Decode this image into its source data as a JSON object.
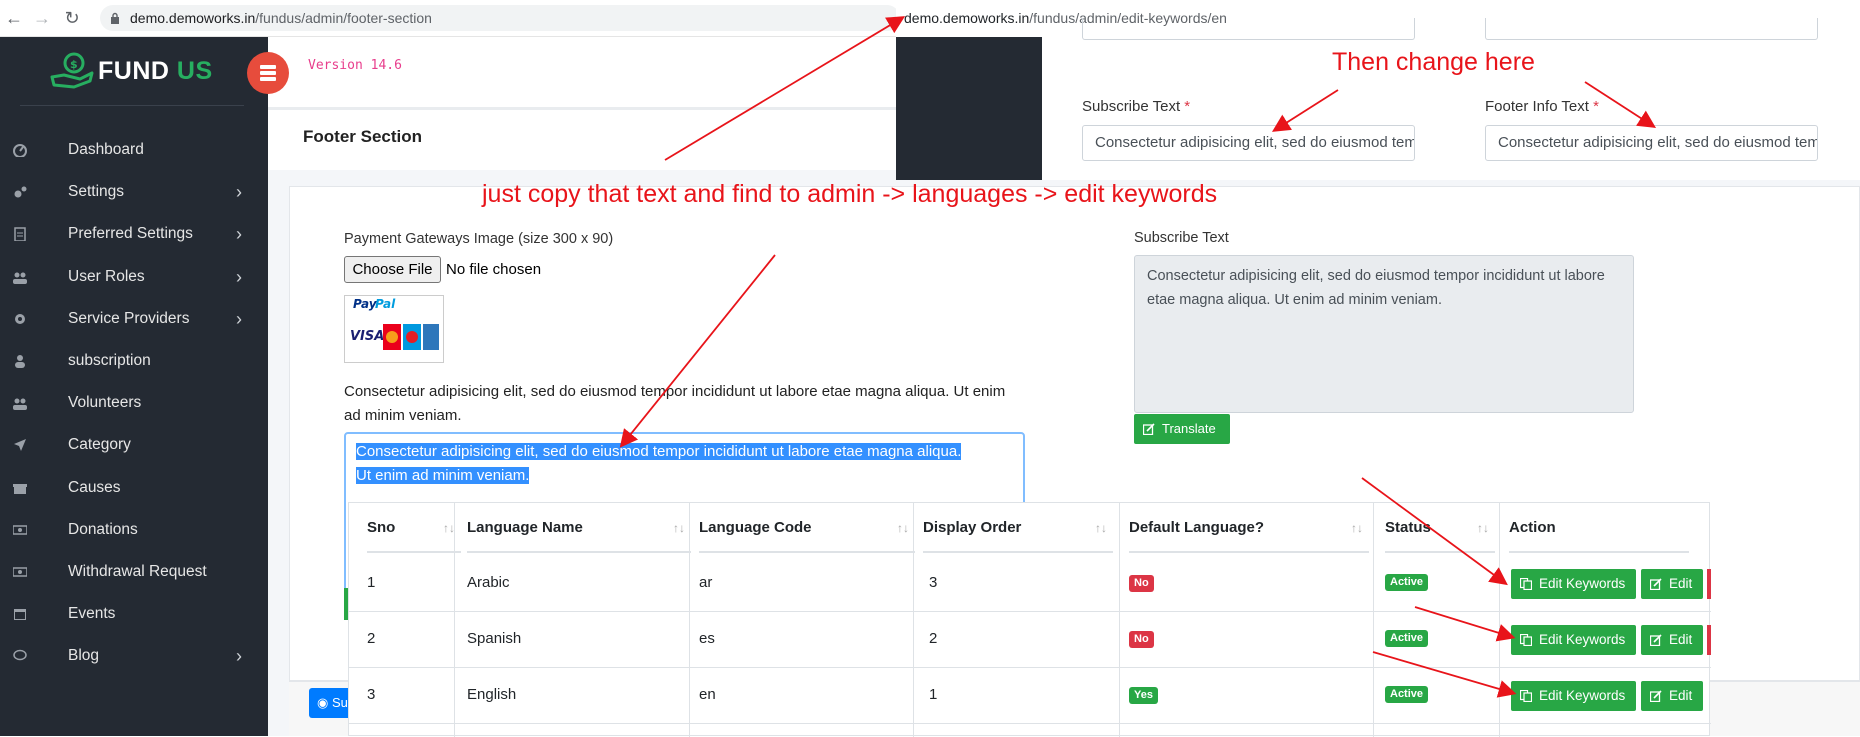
{
  "browser": {
    "url_host": "demo.demoworks.in",
    "url_path": "/fundus/admin/footer-section"
  },
  "brand": {
    "name_part1": "FUND",
    "name_part2": "US",
    "accent": "#27ae60"
  },
  "version": "Version 14.6",
  "sidebar": {
    "items": [
      {
        "label": "Dashboard",
        "icon": "dashboard-icon",
        "chevron": false
      },
      {
        "label": "Settings",
        "icon": "gears-icon",
        "chevron": true
      },
      {
        "label": "Preferred Settings",
        "icon": "file-icon",
        "chevron": true
      },
      {
        "label": "User Roles",
        "icon": "users-icon",
        "chevron": true
      },
      {
        "label": "Service Providers",
        "icon": "gear-icon",
        "chevron": true
      },
      {
        "label": "subscription",
        "icon": "user-icon",
        "chevron": false
      },
      {
        "label": "Volunteers",
        "icon": "users-icon",
        "chevron": false
      },
      {
        "label": "Category",
        "icon": "location-arrow-icon",
        "chevron": false
      },
      {
        "label": "Causes",
        "icon": "gift-icon",
        "chevron": false
      },
      {
        "label": "Donations",
        "icon": "money-icon",
        "chevron": false
      },
      {
        "label": "Withdrawal Request",
        "icon": "money-icon",
        "chevron": false
      },
      {
        "label": "Events",
        "icon": "calendar-icon",
        "chevron": false
      },
      {
        "label": "Blog",
        "icon": "comment-icon",
        "chevron": true
      }
    ]
  },
  "page": {
    "title": "Footer Section",
    "payment_label": "Payment Gateways Image (size 300 x 90)",
    "choose_file": "Choose File",
    "no_file": "No file chosen",
    "paragraph": "Consectetur adipisicing elit, sed do eiusmod tempor incididunt ut labore etae magna aliqua. Ut enim ad minim veniam.",
    "selected_line1": "Consectetur adipisicing elit, sed do eiusmod tempor incididunt ut labore etae magna aliqua.",
    "selected_line2": "Ut enim ad minim veniam.",
    "subscribe_label": "Subscribe Text",
    "subscribe_value": "Consectetur adipisicing elit, sed do eiusmod tempor incididunt ut labore etae magna aliqua. Ut enim ad minim veniam.",
    "translate": "Translate",
    "submit": "Su"
  },
  "overlay_edit": {
    "url_host": "demo.demoworks.in",
    "url_path": "/fundus/admin/edit-keywords/en",
    "subscribe_label": "Subscribe Text",
    "footer_label": "Footer Info Text",
    "required_mark": "*",
    "subscribe_value": "Consectetur adipisicing elit, sed do eiusmod tempor",
    "footer_value": "Consectetur adipisicing elit, sed do eiusmod tempor"
  },
  "languages_table": {
    "headers": [
      "Sno",
      "Language Name",
      "Language Code",
      "Display Order",
      "Default Language?",
      "Status",
      "Action"
    ],
    "rows": [
      {
        "sno": "1",
        "name": "Arabic",
        "code": "ar",
        "order": "3",
        "default": "No",
        "status": "Active"
      },
      {
        "sno": "2",
        "name": "Spanish",
        "code": "es",
        "order": "2",
        "default": "No",
        "status": "Active"
      },
      {
        "sno": "3",
        "name": "English",
        "code": "en",
        "order": "1",
        "default": "Yes",
        "status": "Active"
      }
    ],
    "edit_keywords": "Edit Keywords",
    "edit": "Edit"
  },
  "annotations": {
    "then_change": "Then change here",
    "copy_text": "just copy that text and find to admin -> languages -> edit keywords",
    "color": "#e8141a"
  }
}
